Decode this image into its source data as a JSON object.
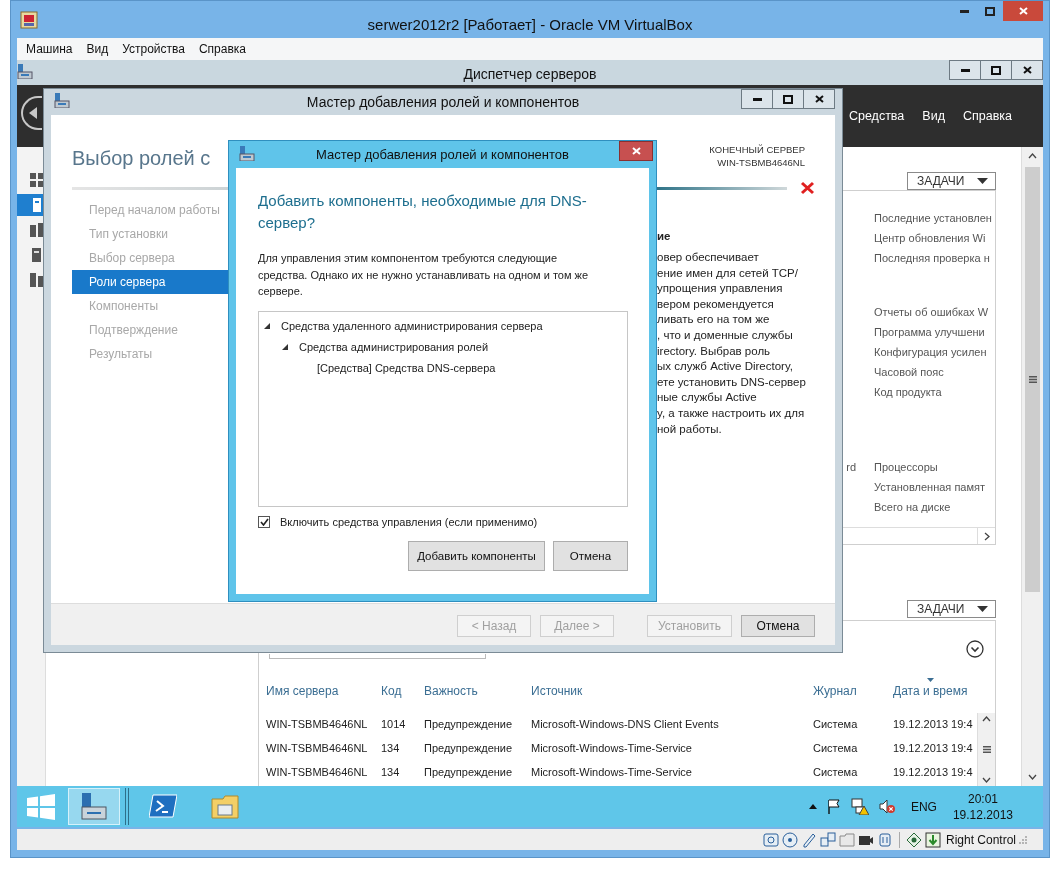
{
  "vbox": {
    "title": "serwer2012r2 [Работает] - Oracle VM VirtualBox",
    "menu": [
      "Машина",
      "Вид",
      "Устройства",
      "Справка"
    ],
    "host_key": "Right Control"
  },
  "server_manager": {
    "title": "Диспетчер серверов",
    "header_menu": [
      "Средства",
      "Вид",
      "Справка"
    ],
    "sidebar": [
      {
        "selected": false
      },
      {
        "selected": true
      },
      {
        "selected": false
      },
      {
        "selected": false
      },
      {
        "selected": false
      }
    ],
    "properties": {
      "tasks": "ЗАДАЧИ",
      "groups": [
        {
          "rows": [
            {
              "value": "Последние установлен"
            },
            {
              "value": "Центр обновления Wi"
            },
            {
              "value": "Последняя проверка н"
            }
          ]
        },
        {
          "rows": [
            {
              "value": "Отчеты об ошибках W"
            },
            {
              "value": "Программа улучшени"
            },
            {
              "value": "Конфигурация усилен"
            },
            {
              "value": "Часовой пояс"
            },
            {
              "value": "Код продукта"
            }
          ]
        },
        {
          "rows": [
            {
              "label": "rd",
              "value": "Процессоры"
            },
            {
              "value": "Установленная памят"
            },
            {
              "value": "Всего на диске"
            }
          ]
        }
      ]
    },
    "events": {
      "tasks": "ЗАДАЧИ",
      "columns": [
        {
          "label": "Имя сервера",
          "sorted": false
        },
        {
          "label": "Код",
          "sorted": false
        },
        {
          "label": "Важность",
          "sorted": false
        },
        {
          "label": "Источник",
          "sorted": false
        },
        {
          "label": "Журнал",
          "sorted": false
        },
        {
          "label": "Дата и время",
          "sorted": true
        }
      ],
      "rows": [
        [
          "WIN-TSBMB4646NL",
          "1014",
          "Предупреждение",
          "Microsoft-Windows-DNS Client Events",
          "Система",
          "19.12.2013 19:4"
        ],
        [
          "WIN-TSBMB4646NL",
          "134",
          "Предупреждение",
          "Microsoft-Windows-Time-Service",
          "Система",
          "19.12.2013 19:4"
        ],
        [
          "WIN-TSBMB4646NL",
          "134",
          "Предупреждение",
          "Microsoft-Windows-Time-Service",
          "Система",
          "19.12.2013 19:4"
        ]
      ]
    }
  },
  "wizard": {
    "title": "Мастер добавления ролей и компонентов",
    "heading": "Выбор ролей с",
    "target_label": "КОНЕЧНЫЙ СЕРВЕР",
    "target_name": "WIN-TSBMB4646NL",
    "nav": [
      {
        "label": "Перед началом работы",
        "selected": false
      },
      {
        "label": "Тип установки",
        "selected": false
      },
      {
        "label": "Выбор сервера",
        "selected": false
      },
      {
        "label": "Роли сервера",
        "selected": true
      },
      {
        "label": "Компоненты",
        "selected": false
      },
      {
        "label": "Подтверждение",
        "selected": false
      },
      {
        "label": "Результаты",
        "selected": false
      }
    ],
    "description_heading": "ие",
    "description_lines": [
      "овер обеспечивает",
      "ение имен для сетей TCP/",
      "упрощения управления",
      "вером рекомендуется",
      "ливать его на том же",
      ", что и доменные службы",
      "irectory. Выбрав роль",
      "ых служб Active Directory,",
      "ете установить DNS-сервер",
      "ные службы Active",
      "y, а также настроить их для",
      "ной работы."
    ],
    "nav_buttons": [
      {
        "label": "< Назад",
        "disabled": true
      },
      {
        "label": "Далее >",
        "disabled": true
      }
    ],
    "action_buttons": [
      {
        "label": "Установить",
        "disabled": true
      },
      {
        "label": "Отмена",
        "disabled": false
      }
    ]
  },
  "dialog": {
    "title": "Мастер добавления ролей и компонентов",
    "heading": "Добавить компоненты, необходимые для DNS-сервер?",
    "message": "Для управления этим компонентом требуются следующие средства. Однако их не нужно устанавливать на одном и том же сервере.",
    "tree": [
      {
        "label": "Средства удаленного администрирования сервера",
        "expanded": true,
        "children": [
          {
            "label": "Средства администрирования ролей",
            "expanded": true,
            "children": [
              {
                "label": "[Средства] Средства DNS-сервера"
              }
            ]
          }
        ]
      }
    ],
    "include_tools": {
      "label": "Включить средства управления (если применимо)",
      "checked": true
    },
    "buttons": [
      "Добавить компоненты",
      "Отмена"
    ]
  },
  "taskbar": {
    "apps": [
      {
        "kind": "server-manager",
        "selected": true
      },
      {
        "kind": "powershell",
        "selected": false
      },
      {
        "kind": "explorer",
        "selected": false
      }
    ],
    "language": "ENG",
    "time": "20:01",
    "date": "19.12.2013"
  }
}
